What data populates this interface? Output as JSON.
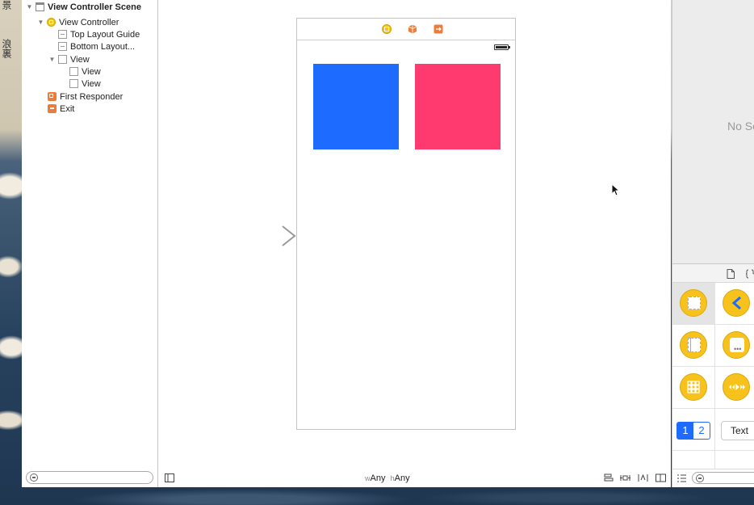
{
  "wallpaper": {
    "chars_top": "景",
    "chars_mid": "浪裏"
  },
  "outline": {
    "scene_title": "View Controller Scene",
    "items": [
      {
        "label": "View Controller Scene"
      },
      {
        "label": "View Controller"
      },
      {
        "label": "Top Layout Guide"
      },
      {
        "label": "Bottom Layout..."
      },
      {
        "label": "View"
      },
      {
        "label": "View"
      },
      {
        "label": "View"
      },
      {
        "label": "First Responder"
      },
      {
        "label": "Exit"
      }
    ],
    "filter_placeholder": ""
  },
  "canvas": {
    "size_class": {
      "w_prefix": "w",
      "w_value": "Any",
      "h_prefix": "h",
      "h_value": "Any"
    },
    "views": [
      {
        "name": "View",
        "color": "#1e6cff"
      },
      {
        "name": "View",
        "color": "#ff3a6f"
      }
    ]
  },
  "inspector": {
    "empty_text": "No Selection"
  },
  "library": {
    "segmented": {
      "first": "1",
      "second": "2"
    },
    "text_button": "Text"
  },
  "colors": {
    "accent": "#1e6cff",
    "pink": "#ff3a6f",
    "icon_yellow": "#f6c21b",
    "icon_orange": "#ec7c3a"
  }
}
